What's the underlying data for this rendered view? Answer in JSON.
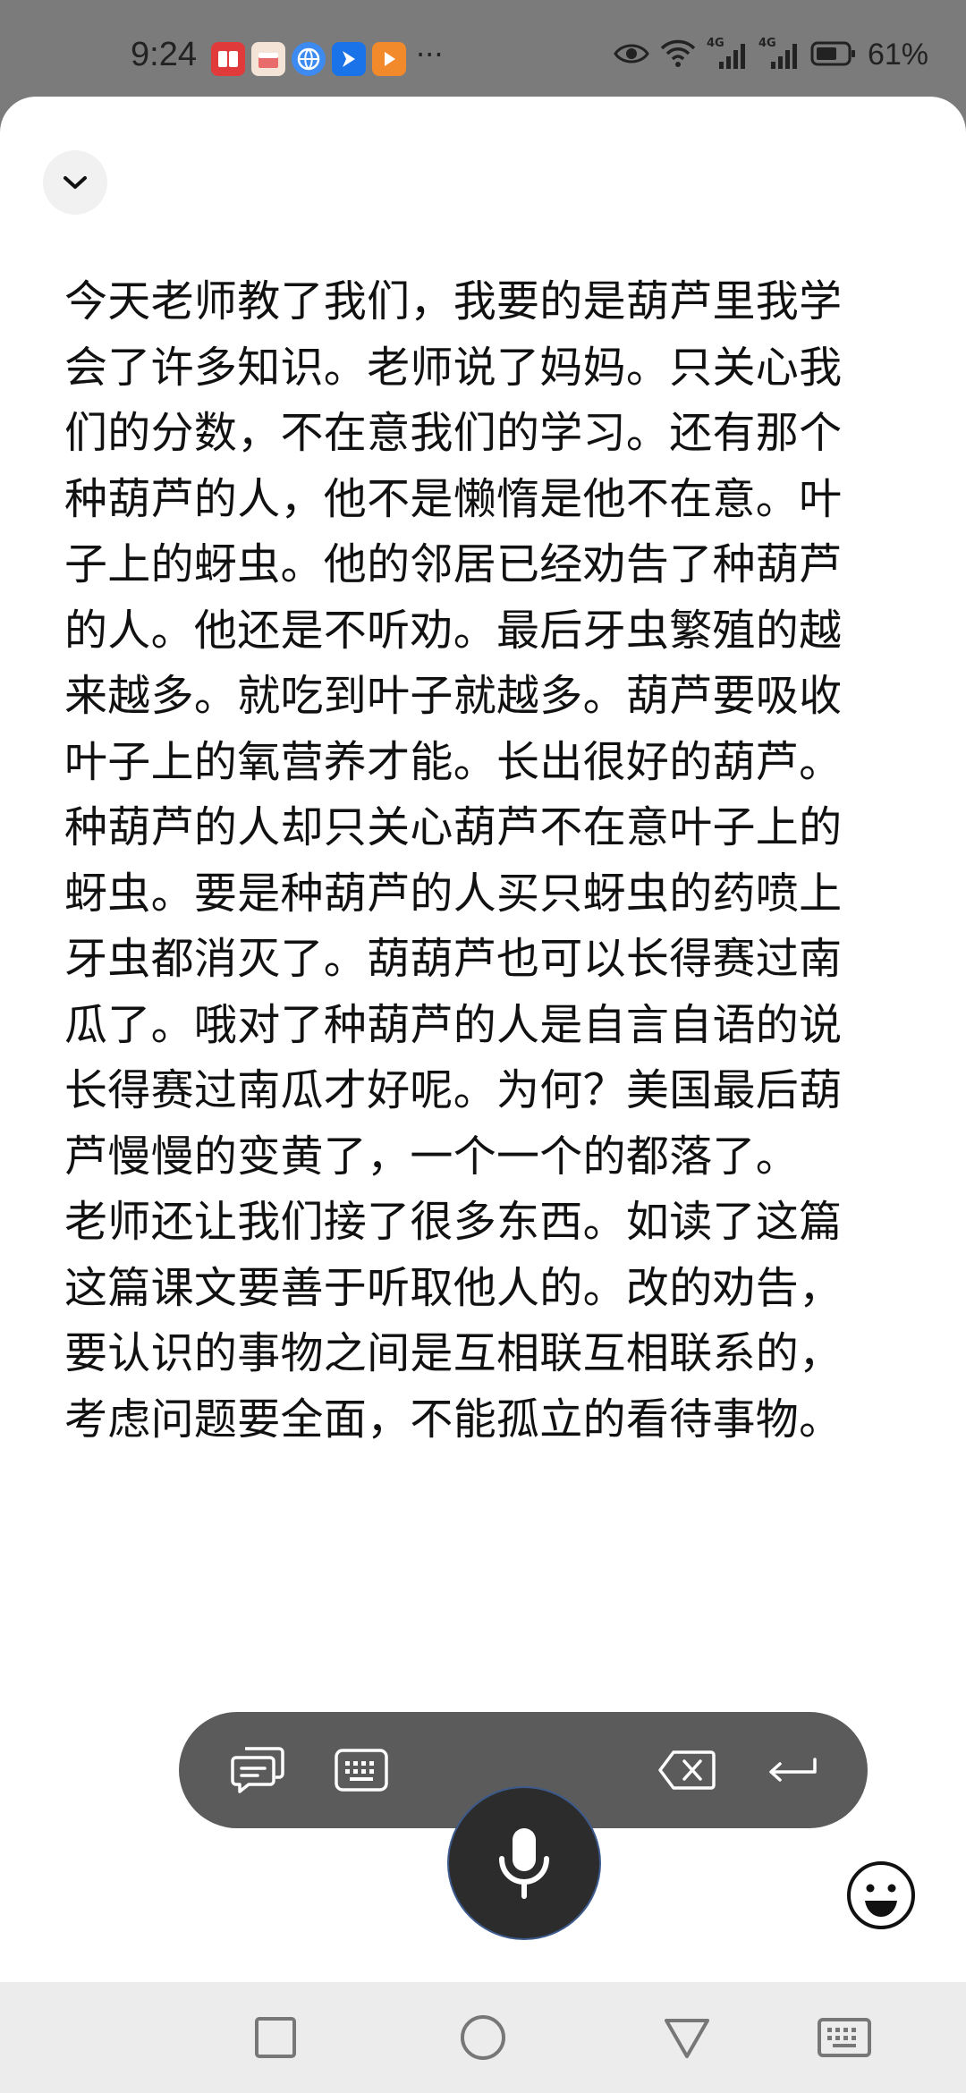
{
  "status_bar": {
    "time": "9:24",
    "more_indicator": "···",
    "battery_percent": "61%",
    "network_label_1": "4G",
    "network_label_2": "4G"
  },
  "app_icons": [
    {
      "name": "red-book-app-icon",
      "color": "#e03a3a"
    },
    {
      "name": "cake-app-icon",
      "color": "#f1d9c8"
    },
    {
      "name": "globe-app-icon",
      "color": "#3d8bf0"
    },
    {
      "name": "blue-bird-app-icon",
      "color": "#1a73e8"
    },
    {
      "name": "orange-play-app-icon",
      "color": "#f28a2c"
    }
  ],
  "transcript": {
    "lines": [
      "今天老师教了我们，我要的是葫芦里我学",
      "会了许多知识。老师说了妈妈。只关心我",
      "们的分数，不在意我们的学习。还有那个",
      "种葫芦的人，他不是懒惰是他不在意。叶",
      "子上的蚜虫。他的邻居已经劝告了种葫芦",
      "的人。他还是不听劝。最后牙虫繁殖的越",
      "来越多。就吃到叶子就越多。葫芦要吸收",
      "叶子上的氧营养才能。长出很好的葫芦。",
      "种葫芦的人却只关心葫芦不在意叶子上的",
      "蚜虫。要是种葫芦的人买只蚜虫的药喷上",
      "牙虫都消灭了。葫葫芦也可以长得赛过南",
      "瓜了。哦对了种葫芦的人是自言自语的说",
      "长得赛过南瓜才好呢。为何？美国最后葫",
      "芦慢慢的变黄了，一个一个的都落了。",
      "老师还让我们接了很多东西。如读了这篇",
      "这篇课文要善于听取他人的。改的劝告，",
      "要认识的事物之间是互相联互相联系的，",
      "考虑问题要全面，不能孤立的看待事物。"
    ]
  },
  "toolbar": {
    "buttons": [
      "chat-bubbles-icon",
      "keyboard-icon",
      "microphone-icon",
      "backspace-icon",
      "enter-icon",
      "emoji-icon"
    ]
  },
  "nav_bar": {
    "buttons": [
      "recents-square-icon",
      "home-circle-icon",
      "back-triangle-icon",
      "keyboard-hide-icon"
    ]
  },
  "colors": {
    "status_bar_bg": "#7b7b7b",
    "panel_bg": "#ffffff",
    "toolbar_bg": "#5b5b5b",
    "mic_bg": "#2c2c2c",
    "nav_bg": "#ececec"
  }
}
